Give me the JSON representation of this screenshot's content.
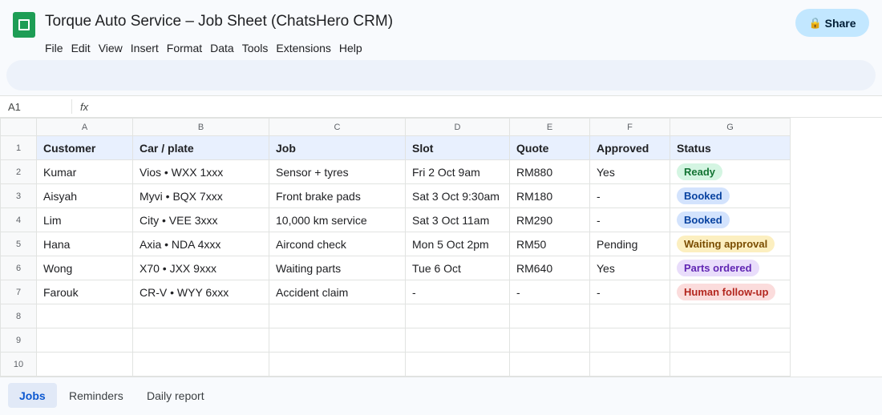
{
  "app": {
    "title": "Torque Auto Service – Job Sheet (ChatsHero CRM)",
    "logo_icon": "sheets-logo-icon",
    "menus": [
      "File",
      "Edit",
      "View",
      "Insert",
      "Format",
      "Data",
      "Tools",
      "Extensions",
      "Help"
    ],
    "share_label": "Share",
    "share_icon": "lock-icon"
  },
  "formula_bar": {
    "cell_ref": "A1",
    "fx_label": "fx"
  },
  "sheet": {
    "column_letters": [
      "A",
      "B",
      "C",
      "D",
      "E",
      "F",
      "G"
    ],
    "row_numbers": [
      "1",
      "2",
      "3",
      "4",
      "5",
      "6",
      "7",
      "8",
      "9",
      "10"
    ],
    "headers": [
      "Customer",
      "Car / plate",
      "Job",
      "Slot",
      "Quote",
      "Approved",
      "Status"
    ],
    "rows": [
      {
        "customer": "Kumar",
        "car": "Vios  •  WXX 1xxx",
        "job": "Sensor + tyres",
        "slot": "Fri 2 Oct 9am",
        "quote": "RM880",
        "approved": "Yes",
        "status": "Ready"
      },
      {
        "customer": "Aisyah",
        "car": "Myvi  •  BQX 7xxx",
        "job": "Front brake pads",
        "slot": "Sat 3 Oct 9:30am",
        "quote": "RM180",
        "approved": "-",
        "status": "Booked"
      },
      {
        "customer": "Lim",
        "car": "City  •  VEE 3xxx",
        "job": "10,000 km service",
        "slot": "Sat 3 Oct 11am",
        "quote": "RM290",
        "approved": "-",
        "status": "Booked"
      },
      {
        "customer": "Hana",
        "car": "Axia  •  NDA 4xxx",
        "job": "Aircond check",
        "slot": "Mon 5 Oct 2pm",
        "quote": "RM50",
        "approved": "Pending",
        "status": "Waiting approval"
      },
      {
        "customer": "Wong",
        "car": "X70  •  JXX 9xxx",
        "job": "Waiting parts",
        "slot": "Tue 6 Oct",
        "quote": "RM640",
        "approved": "Yes",
        "status": "Parts ordered"
      },
      {
        "customer": "Farouk",
        "car": "CR-V  •  WYY 6xxx",
        "job": "Accident claim",
        "slot": "-",
        "quote": "-",
        "approved": "-",
        "status": "Human follow-up"
      }
    ]
  },
  "status_colors": {
    "Ready": {
      "bg": "#d4f5e2",
      "fg": "#137333"
    },
    "Booked": {
      "bg": "#d3e3fd",
      "fg": "#0842a0"
    },
    "Waiting approval": {
      "bg": "#fcefc0",
      "fg": "#7a4d00"
    },
    "Parts ordered": {
      "bg": "#e9ddfb",
      "fg": "#6126b3"
    },
    "Human follow-up": {
      "bg": "#fbdcdc",
      "fg": "#b3261e"
    }
  },
  "tabs": [
    {
      "label": "Jobs",
      "active": true
    },
    {
      "label": "Reminders",
      "active": false
    },
    {
      "label": "Daily report",
      "active": false
    }
  ]
}
